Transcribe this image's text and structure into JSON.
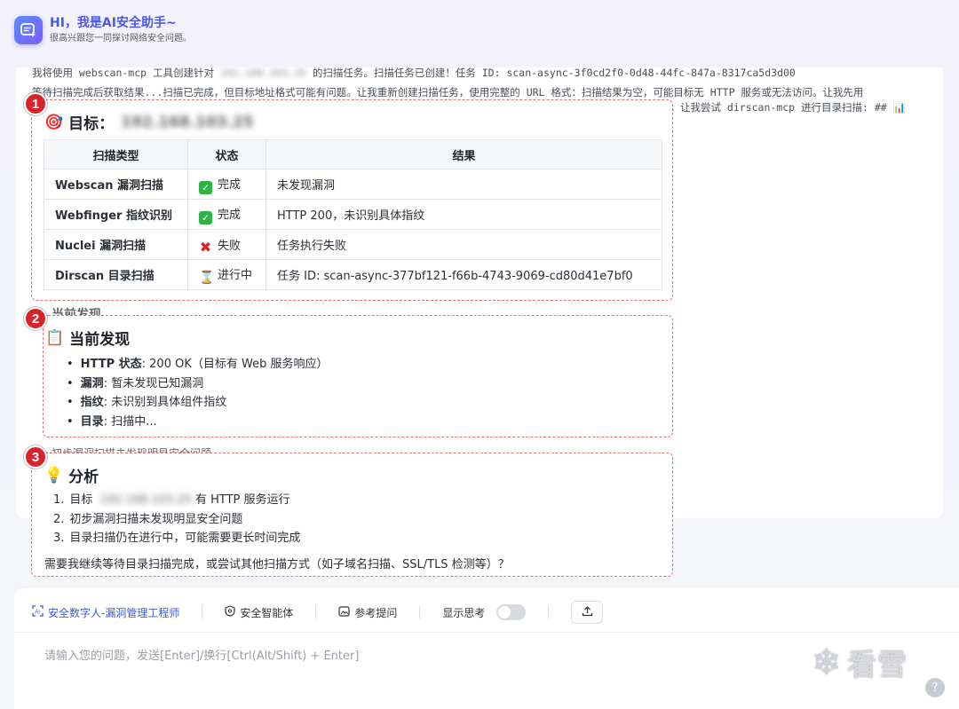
{
  "header": {
    "title": "HI，我是AI安全助手~",
    "subtitle": "很高兴跟您一同探讨网络安全问题。"
  },
  "stream": {
    "line1_prefix": "我将使用 webscan-mcp 工具创建针对",
    "line1_ip": "192.168.103.25",
    "line1_suffix": "的扫描任务。扫描任务已创建！任务 ID: scan-async-3f0cd2f0-0d48-44fc-847a-8317ca5d3d00",
    "line2": "等待扫描完成后获取结果...扫描已完成，但目标地址格式可能有问题。让我重新创建扫描任务，使用完整的 URL 格式：扫描结果为空，可能目标无 HTTP 服务或无法访问。让我先用",
    "line3": "败。让我尝试 dirscan-mcp 进行目录扫描: ## 📊",
    "ghost1": "当前发现",
    "ghost2": "初步漏洞扫描未发现明显安全问题"
  },
  "badges": [
    "1",
    "2",
    "3"
  ],
  "section1": {
    "emoji": "🎯",
    "title": "目标：",
    "target_ip": "192.168.103.25",
    "headers": [
      "扫描类型",
      "状态",
      "结果"
    ],
    "rows": [
      {
        "type": "Webscan 漏洞扫描",
        "status_icon": "✓",
        "status": "完成",
        "result": "未发现漏洞"
      },
      {
        "type": "Webfinger 指纹识别",
        "status_icon": "✓",
        "status": "完成",
        "result": "HTTP 200，未识别具体指纹"
      },
      {
        "type": "Nuclei 漏洞扫描",
        "status_icon": "✖",
        "status": "失败",
        "result": "任务执行失败"
      },
      {
        "type": "Dirscan 目录扫描",
        "status_icon": "⌛",
        "status": "进行中",
        "result": "任务 ID: scan-async-377bf121-f66b-4743-9069-cd80d41e7bf0"
      }
    ]
  },
  "section2": {
    "emoji": "📋",
    "title": "当前发现",
    "items": [
      {
        "label": "HTTP 状态",
        "value": ": 200 OK（目标有 Web 服务响应）"
      },
      {
        "label": "漏洞",
        "value": ": 暂未发现已知漏洞"
      },
      {
        "label": "指纹",
        "value": ": 未识别到具体组件指纹"
      },
      {
        "label": "目录",
        "value": ": 扫描中..."
      }
    ]
  },
  "section3": {
    "emoji": "💡",
    "title": "分析",
    "items": [
      {
        "num": "1.",
        "prefix": "目标",
        "ip": "192.168.103.25",
        "suffix": "有 HTTP 服务运行"
      },
      {
        "num": "2.",
        "text": "初步漏洞扫描未发现明显安全问题"
      },
      {
        "num": "3.",
        "text": "目录扫描仍在进行中，可能需要更长时间完成"
      }
    ],
    "question": "需要我继续等待目录扫描完成，或尝试其他扫描方式（如子域名扫描、SSL/TLS 检测等）？"
  },
  "toolbar": {
    "agent_label": "安全数字人-漏洞管理工程师",
    "smart_label": "安全智能体",
    "ref_label": "参考提问",
    "think_label": "显示思考",
    "think_on": false
  },
  "input": {
    "placeholder": "请输入您的问题，发送[Enter]/换行[Ctrl(Alt/Shift) + Enter]",
    "value": ""
  },
  "watermark": {
    "text": "看雪"
  },
  "colors": {
    "accent": "#4a57e8",
    "badge": "#d8232a",
    "ok": "#2fb344"
  }
}
